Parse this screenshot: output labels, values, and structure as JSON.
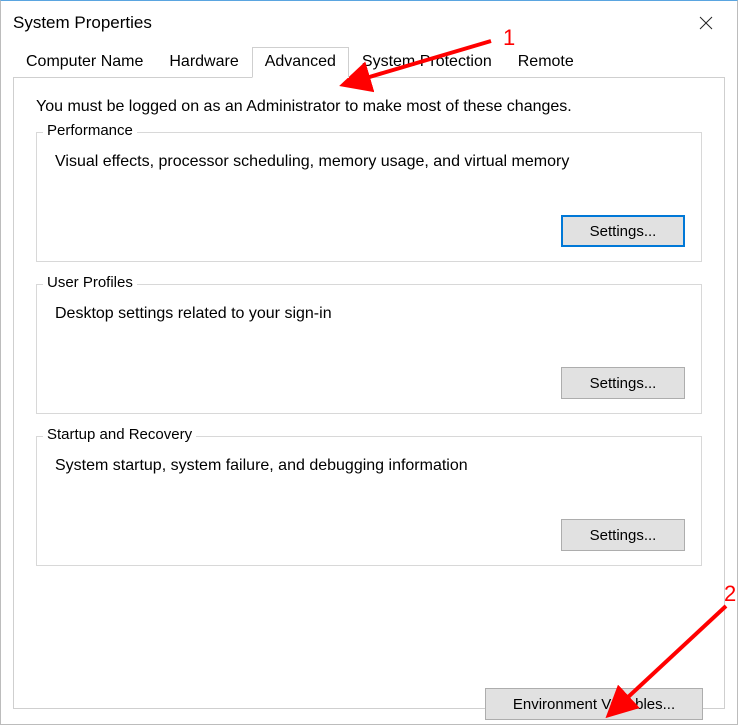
{
  "window": {
    "title": "System Properties"
  },
  "tabs": [
    {
      "label": "Computer Name"
    },
    {
      "label": "Hardware"
    },
    {
      "label": "Advanced"
    },
    {
      "label": "System Protection"
    },
    {
      "label": "Remote"
    }
  ],
  "active_tab_index": 2,
  "panel": {
    "intro": "You must be logged on as an Administrator to make most of these changes.",
    "groups": [
      {
        "legend": "Performance",
        "desc": "Visual effects, processor scheduling, memory usage, and virtual memory",
        "button": "Settings...",
        "highlight": true
      },
      {
        "legend": "User Profiles",
        "desc": "Desktop settings related to your sign-in",
        "button": "Settings...",
        "highlight": false
      },
      {
        "legend": "Startup and Recovery",
        "desc": "System startup, system failure, and debugging information",
        "button": "Settings...",
        "highlight": false
      }
    ],
    "env_button": "Environment Variables..."
  },
  "annotations": {
    "label1": "1",
    "label2": "2"
  }
}
